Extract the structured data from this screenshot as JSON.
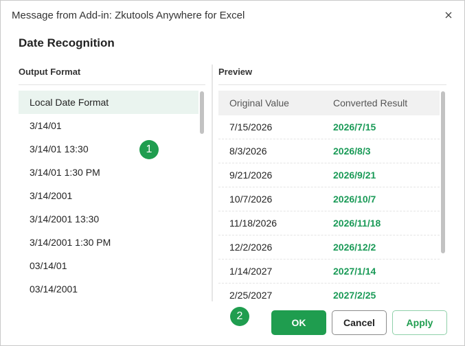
{
  "dialog": {
    "title": "Message from Add-in: Zkutools Anywhere for Excel",
    "heading": "Date Recognition"
  },
  "output_format": {
    "label": "Output Format",
    "items": [
      "Local Date Format",
      "3/14/01",
      "3/14/01 13:30",
      "3/14/01 1:30 PM",
      "3/14/2001",
      "3/14/2001 13:30",
      "3/14/2001 1:30 PM",
      "03/14/01",
      "03/14/2001"
    ],
    "selected_index": 0
  },
  "preview": {
    "label": "Preview",
    "columns": [
      "Original Value",
      "Converted Result"
    ],
    "rows": [
      [
        "7/15/2026",
        "2026/7/15"
      ],
      [
        "8/3/2026",
        "2026/8/3"
      ],
      [
        "9/21/2026",
        "2026/9/21"
      ],
      [
        "10/7/2026",
        "2026/10/7"
      ],
      [
        "11/18/2026",
        "2026/11/18"
      ],
      [
        "12/2/2026",
        "2026/12/2"
      ],
      [
        "1/14/2027",
        "2027/1/14"
      ],
      [
        "2/25/2027",
        "2027/2/25"
      ]
    ]
  },
  "badges": [
    "1",
    "2"
  ],
  "buttons": {
    "ok": "OK",
    "cancel": "Cancel",
    "apply": "Apply"
  },
  "colors": {
    "accent": "#1f9d4f",
    "selected_bg": "#eaf4ef",
    "converted_text": "#1a9a57"
  },
  "icons": {
    "close": "close-icon"
  }
}
